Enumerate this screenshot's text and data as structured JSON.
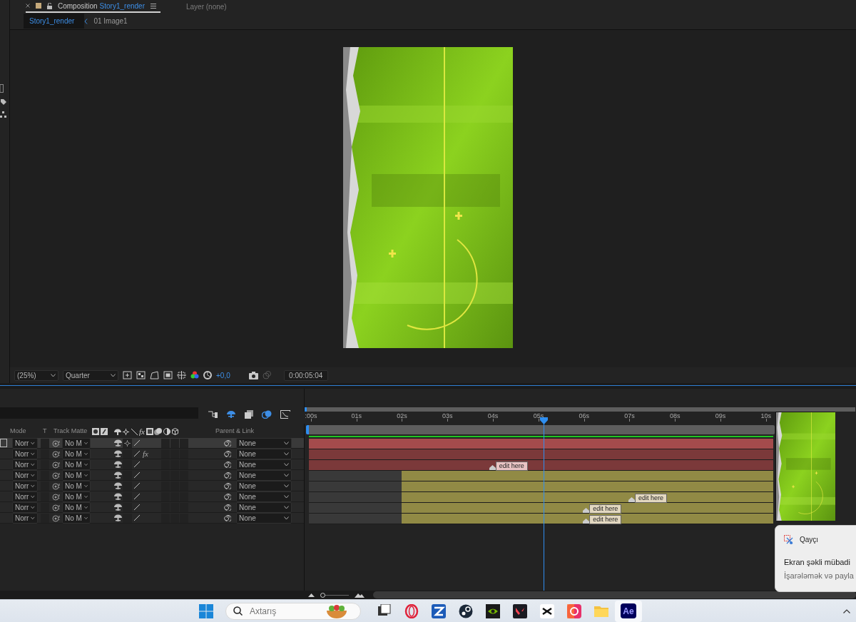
{
  "panel_tabs": [
    {
      "kind": "composition",
      "label": "Composition",
      "name": "Story1_render",
      "selected": true
    },
    {
      "kind": "layer",
      "label": "Layer (none)",
      "selected": false
    }
  ],
  "breadcrumbs": [
    {
      "label": "Story1_render",
      "selected": true
    },
    {
      "label": "01 Image1",
      "selected": false
    }
  ],
  "viewer": {
    "toolbar": {
      "magnification": "(25%)",
      "resolution": "Quarter",
      "exposure": "+0,0",
      "timecode": "0:00:05:04"
    }
  },
  "timeline": {
    "columns": {
      "mode": "Mode",
      "t": "T",
      "track_matte": "Track Matte",
      "fx": "fx",
      "parent": "Parent & Link"
    },
    "layers": [
      {
        "mode": "Norr",
        "track_matte": "No M",
        "parent": "None",
        "selected": true,
        "quality": true
      },
      {
        "mode": "Norr",
        "track_matte": "No M",
        "parent": "None",
        "selected": false,
        "quality": false,
        "effects": "fx"
      },
      {
        "mode": "Norr",
        "track_matte": "No M",
        "parent": "None",
        "selected": false,
        "quality": false
      },
      {
        "mode": "Norr",
        "track_matte": "No M",
        "parent": "None",
        "selected": false,
        "quality": false
      },
      {
        "mode": "Norr",
        "track_matte": "No M",
        "parent": "None",
        "selected": false,
        "quality": false
      },
      {
        "mode": "Norr",
        "track_matte": "No M",
        "parent": "None",
        "selected": false,
        "quality": false
      },
      {
        "mode": "Norr",
        "track_matte": "No M",
        "parent": "None",
        "selected": false,
        "quality": false
      },
      {
        "mode": "Norr",
        "track_matte": "No M",
        "parent": "None",
        "selected": false,
        "quality": false
      }
    ],
    "ruler": [
      ":00s",
      "01s",
      "02s",
      "03s",
      "04s",
      "05s",
      "06s",
      "07s",
      "08s",
      "09s",
      "10s"
    ],
    "playhead": {
      "level": 0.506
    },
    "tracks": [
      {
        "color": "#a44b4c",
        "level": 1
      },
      {
        "color": "#7b393a",
        "level": 1
      },
      {
        "color": "#7b393a",
        "level": 1,
        "markers": [
          {
            "label": "edit here",
            "level": 0.395
          }
        ]
      },
      {
        "color": "#918a45",
        "level": 0.8
      },
      {
        "color": "#918a45",
        "level": 0.8
      },
      {
        "color": "#918a45",
        "level": 0.8,
        "markers": [
          {
            "label": "edit here",
            "level": 0.695
          }
        ]
      },
      {
        "color": "#918a45",
        "level": 0.8,
        "markers": [
          {
            "label": "edit here",
            "level": 0.597
          }
        ]
      },
      {
        "color": "#918a45",
        "level": 0.8,
        "markers": [
          {
            "label": "edit here",
            "level": 0.597
          }
        ]
      }
    ],
    "zoom_slider": {
      "level": 0.08
    }
  },
  "notification": {
    "app": "Qayçı",
    "title": "Ekran şəkli mübadi",
    "body": "İşarələmək və payla"
  },
  "taskbar": {
    "search": {
      "placeholder": "Axtarış"
    },
    "apps": [
      {
        "kind": "window",
        "selected": false
      },
      {
        "kind": "opera",
        "selected": false
      },
      {
        "kind": "z",
        "selected": false
      },
      {
        "kind": "steam",
        "selected": false
      },
      {
        "kind": "nvidia",
        "selected": false
      },
      {
        "kind": "valorant",
        "selected": false
      },
      {
        "kind": "capcut",
        "selected": false
      },
      {
        "kind": "cloud",
        "selected": false
      },
      {
        "kind": "folder",
        "selected": false
      },
      {
        "kind": "ae",
        "label": "Ae",
        "selected": true
      }
    ]
  }
}
